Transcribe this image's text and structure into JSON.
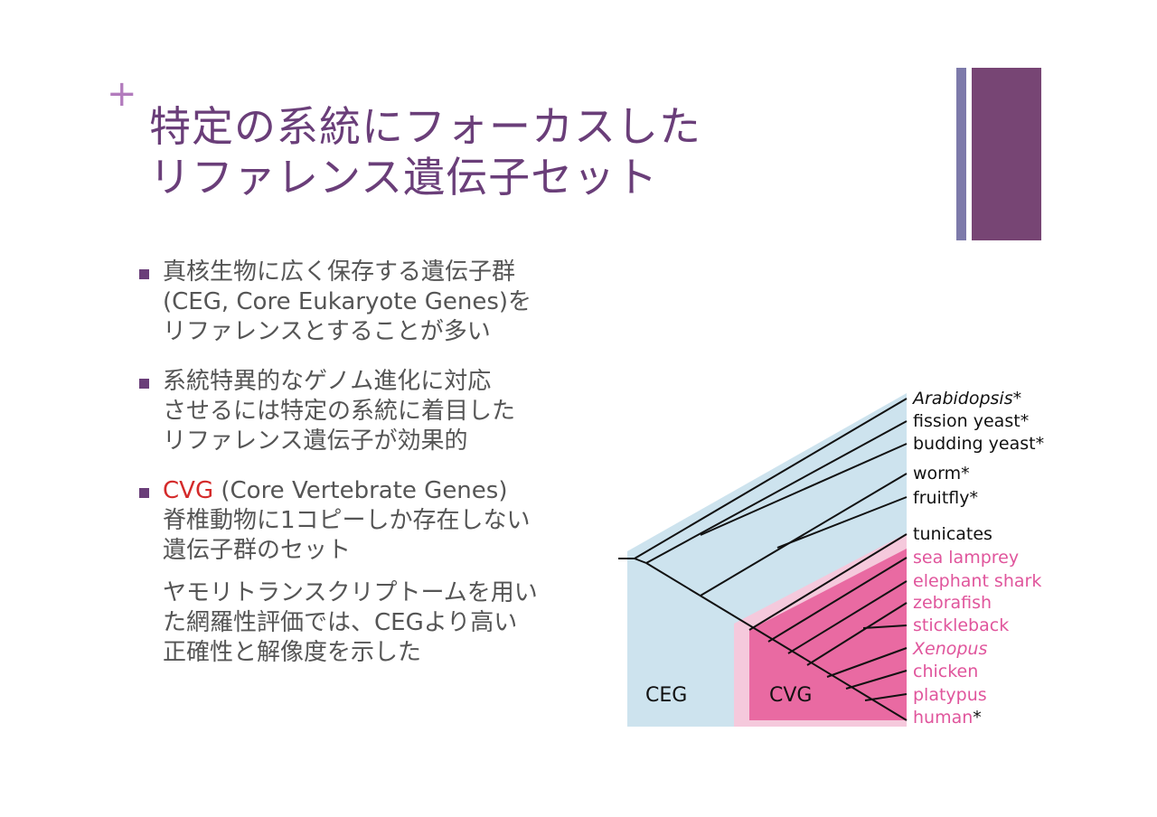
{
  "slide": {
    "plus_glyph": "+",
    "title_lines": [
      "特定の系統にフォーカスした",
      "リファレンス遺伝子セット"
    ],
    "accent_colors": {
      "title": "#6a3e79",
      "bar_thin": "#7d7aaa",
      "bar_thick": "#774574"
    }
  },
  "bullets": [
    {
      "lines": [
        "真核生物に広く保存する遺伝子群",
        "(CEG, Core Eukaryote Genes)を",
        "リファレンスとすることが多い"
      ]
    },
    {
      "lines": [
        "系統特異的なゲノム進化に対応",
        "させるには特定の系統に着目した",
        "リファレンス遺伝子が効果的"
      ]
    },
    {
      "highlight": "CVG",
      "first_rest": " (Core Vertebrate Genes)",
      "lines": [
        "脊椎動物に1コピーしか存在しない",
        "遺伝子群のセット"
      ],
      "sub_lines": [
        "ヤモリトランスクリプトームを用い",
        "た網羅性評価では、CEGより高い",
        "正確性と解像度を示した"
      ]
    }
  ],
  "diagram": {
    "regions": {
      "ceg": "CEG",
      "cvg": "CVG"
    },
    "colors": {
      "ceg_fill": "#cde3ee",
      "cvg_outer": "#f5c9dc",
      "cvg_inner": "#e96aa2",
      "pink_text": "#e0559c"
    },
    "taxa": [
      {
        "name": "Arabidopsis",
        "suffix": "*",
        "italic": true,
        "color": "black"
      },
      {
        "name": "fission yeast",
        "suffix": "*",
        "italic": false,
        "color": "black"
      },
      {
        "name": "budding yeast",
        "suffix": "*",
        "italic": false,
        "color": "black"
      },
      {
        "name": "worm",
        "suffix": "*",
        "italic": false,
        "color": "black"
      },
      {
        "name": "fruitfly",
        "suffix": "*",
        "italic": false,
        "color": "black"
      },
      {
        "name": "tunicates",
        "suffix": "",
        "italic": false,
        "color": "black"
      },
      {
        "name": "sea lamprey",
        "suffix": "",
        "italic": false,
        "color": "pink"
      },
      {
        "name": "elephant shark",
        "suffix": "",
        "italic": false,
        "color": "pink"
      },
      {
        "name": "zebrafish",
        "suffix": "",
        "italic": false,
        "color": "pink"
      },
      {
        "name": "stickleback",
        "suffix": "",
        "italic": false,
        "color": "pink"
      },
      {
        "name": "Xenopus",
        "suffix": "",
        "italic": true,
        "color": "pink"
      },
      {
        "name": "chicken",
        "suffix": "",
        "italic": false,
        "color": "pink"
      },
      {
        "name": "platypus",
        "suffix": "",
        "italic": false,
        "color": "pink"
      },
      {
        "name": "human",
        "suffix": "*",
        "italic": false,
        "color": "pink"
      }
    ]
  }
}
